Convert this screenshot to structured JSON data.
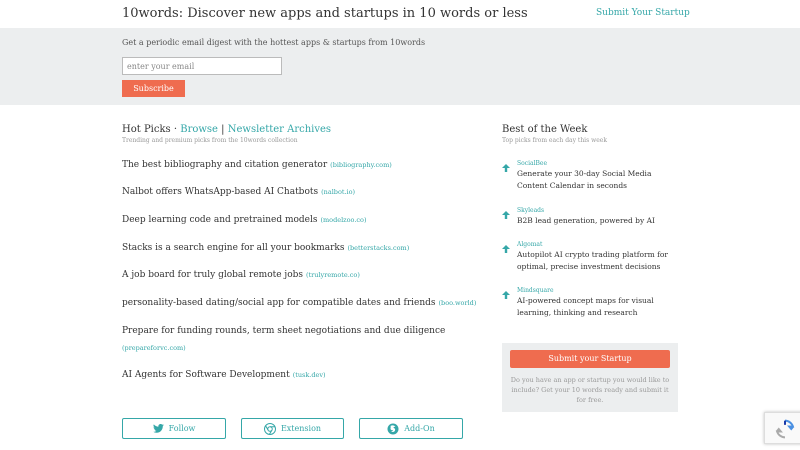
{
  "header": {
    "site_title": "10words: Discover new apps and startups in 10 words or less",
    "submit_link": "Submit Your Startup"
  },
  "newsletter": {
    "text": "Get a periodic email digest with the hottest apps & startups from 10words",
    "email_placeholder": "enter your email",
    "subscribe_label": "Subscribe"
  },
  "hot_picks": {
    "title": "Hot Picks",
    "separator1": " · ",
    "browse_label": "Browse",
    "separator2": " | ",
    "archives_label": "Newsletter Archives",
    "subtitle": "Trending and premium picks from the 10words collection",
    "items": [
      {
        "text": "The best bibliography and citation generator",
        "domain": "(bibliography.com)"
      },
      {
        "text": "Nalbot offers WhatsApp-based AI Chatbots",
        "domain": "(nalbot.io)"
      },
      {
        "text": "Deep learning code and pretrained models",
        "domain": "(modelzoo.co)"
      },
      {
        "text": "Stacks is a search engine for all your bookmarks",
        "domain": "(betterstacks.com)"
      },
      {
        "text": "A job board for truly global remote jobs",
        "domain": "(trulyremote.co)"
      },
      {
        "text": "personality-based dating/social app for compatible dates and friends",
        "domain": "(boo.world)"
      },
      {
        "text": "Prepare for funding rounds, term sheet negotiations and due diligence",
        "domain": "(prepareforvc.com)"
      },
      {
        "text": "AI Agents for Software Development",
        "domain": "(tusk.dev)"
      }
    ]
  },
  "follow": {
    "follow_label": "Follow",
    "extension_label": "Extension",
    "addon_label": "Add-On"
  },
  "best_of_week": {
    "title": "Best of the Week",
    "subtitle": "Top picks from each day this week",
    "items": [
      {
        "tag": "SocialBee",
        "text": "Generate your 30-day Social Media Content Calendar in seconds"
      },
      {
        "tag": "Skyleads",
        "text": "B2B lead generation, powered by AI"
      },
      {
        "tag": "Algomat",
        "text": "Autopilot AI crypto trading platform for optimal, precise investment decisions"
      },
      {
        "tag": "Mindsquare",
        "text": "AI-powered concept maps for visual learning, thinking and research"
      }
    ]
  },
  "submit_box": {
    "button_label": "Submit your Startup",
    "note": "Do you have an app or startup you would like to include? Get your 10 words ready and submit it for free."
  },
  "colors": {
    "accent": "#35a7a8",
    "cta": "#ef6c4f",
    "band": "#eceeef"
  }
}
